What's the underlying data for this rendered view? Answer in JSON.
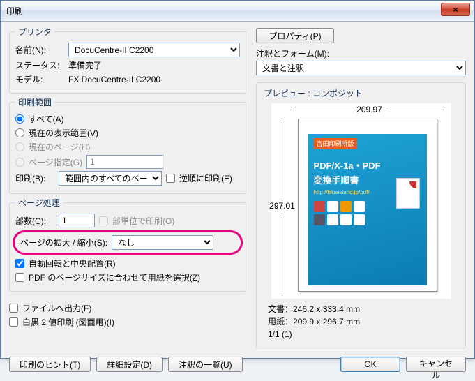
{
  "window": {
    "title": "印刷",
    "close": "×"
  },
  "printer": {
    "legend": "プリンタ",
    "name_label": "名前(N):",
    "name_value": "DocuCentre-II C2200",
    "properties_btn": "プロパティ(P)",
    "status_label": "ステータス:",
    "status_value": "準備完了",
    "model_label": "モデル:",
    "model_value": "FX DocuCentre-II C2200",
    "comments_form_label": "注釈とフォーム(M):",
    "comments_form_value": "文書と注釈"
  },
  "range": {
    "legend": "印刷範囲",
    "all": "すべて(A)",
    "view": "現在の表示範囲(V)",
    "current": "現在のページ(H)",
    "pages": "ページ指定(G)",
    "pages_value": "1",
    "subset_label": "印刷(B):",
    "subset_value": "範囲内のすべてのページ",
    "reverse": "逆順に印刷(E)"
  },
  "handling": {
    "legend": "ページ処理",
    "copies_label": "部数(C):",
    "copies_value": "1",
    "collate": "部単位で印刷(O)",
    "scaling_label": "ページの拡大 / 縮小(S):",
    "scaling_value": "なし",
    "autorotate": "自動回転と中央配置(R)",
    "choosepaper": "PDF のページサイズに合わせて用紙を選択(Z)"
  },
  "output": {
    "tofile": "ファイルへ出力(F)",
    "duplex": "白黒 2 値印刷 (図面用)(I)"
  },
  "preview": {
    "title": "プレビュー : コンポジット",
    "width": "209.97",
    "height": "297.01",
    "doc_hdr": "吉田印刷所版",
    "doc_t1": "PDF/X-1a・PDF",
    "doc_t2": "変換手順書",
    "doc_url": "http://blueisland.jp/pdf/",
    "docsize_label": "文書：",
    "docsize": "246.2 x 333.4  mm",
    "paper_label": "用紙：",
    "paper": "209.9 x 296.7  mm",
    "pageof": "1/1 (1)"
  },
  "buttons": {
    "hints": "印刷のヒント(T)",
    "advanced": "詳細設定(D)",
    "comments": "注釈の一覧(U)",
    "ok": "OK",
    "cancel": "キャンセル"
  }
}
